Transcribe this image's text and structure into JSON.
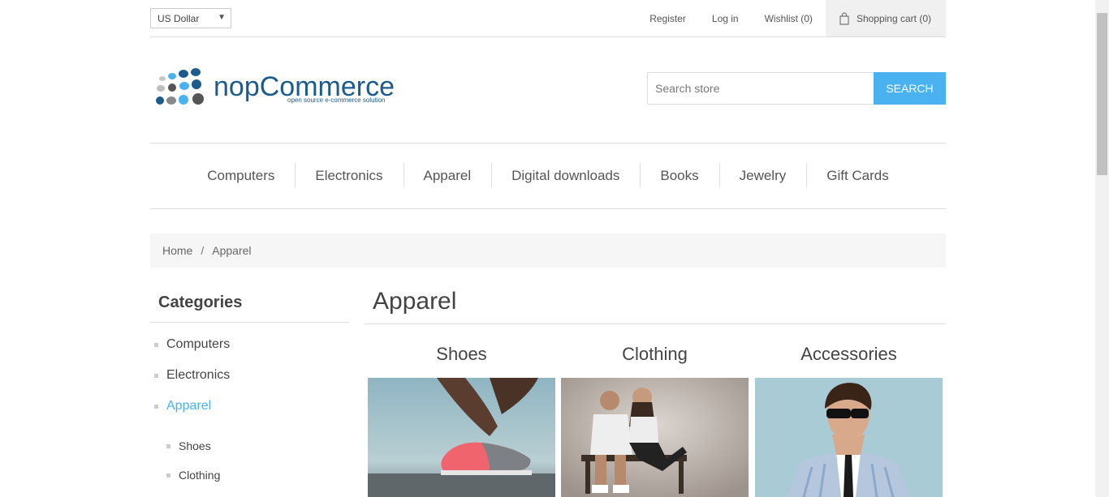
{
  "header": {
    "currency": "US Dollar",
    "links": {
      "register": "Register",
      "login": "Log in",
      "wishlist": "Wishlist (0)",
      "cart": "Shopping cart (0)"
    }
  },
  "logo": {
    "brand": "nopCommerce",
    "tagline": "open source e-commerce solution"
  },
  "search": {
    "placeholder": "Search store",
    "button": "SEARCH"
  },
  "menu": [
    "Computers",
    "Electronics",
    "Apparel",
    "Digital downloads",
    "Books",
    "Jewelry",
    "Gift Cards"
  ],
  "breadcrumb": {
    "home": "Home",
    "separator": "/",
    "current": "Apparel"
  },
  "sidebar": {
    "title": "Categories",
    "items": [
      "Computers",
      "Electronics",
      "Apparel"
    ],
    "subitems": [
      "Shoes",
      "Clothing"
    ]
  },
  "main": {
    "title": "Apparel",
    "subcategories": [
      "Shoes",
      "Clothing",
      "Accessories"
    ]
  },
  "colors": {
    "accent": "#4ab2f1"
  }
}
